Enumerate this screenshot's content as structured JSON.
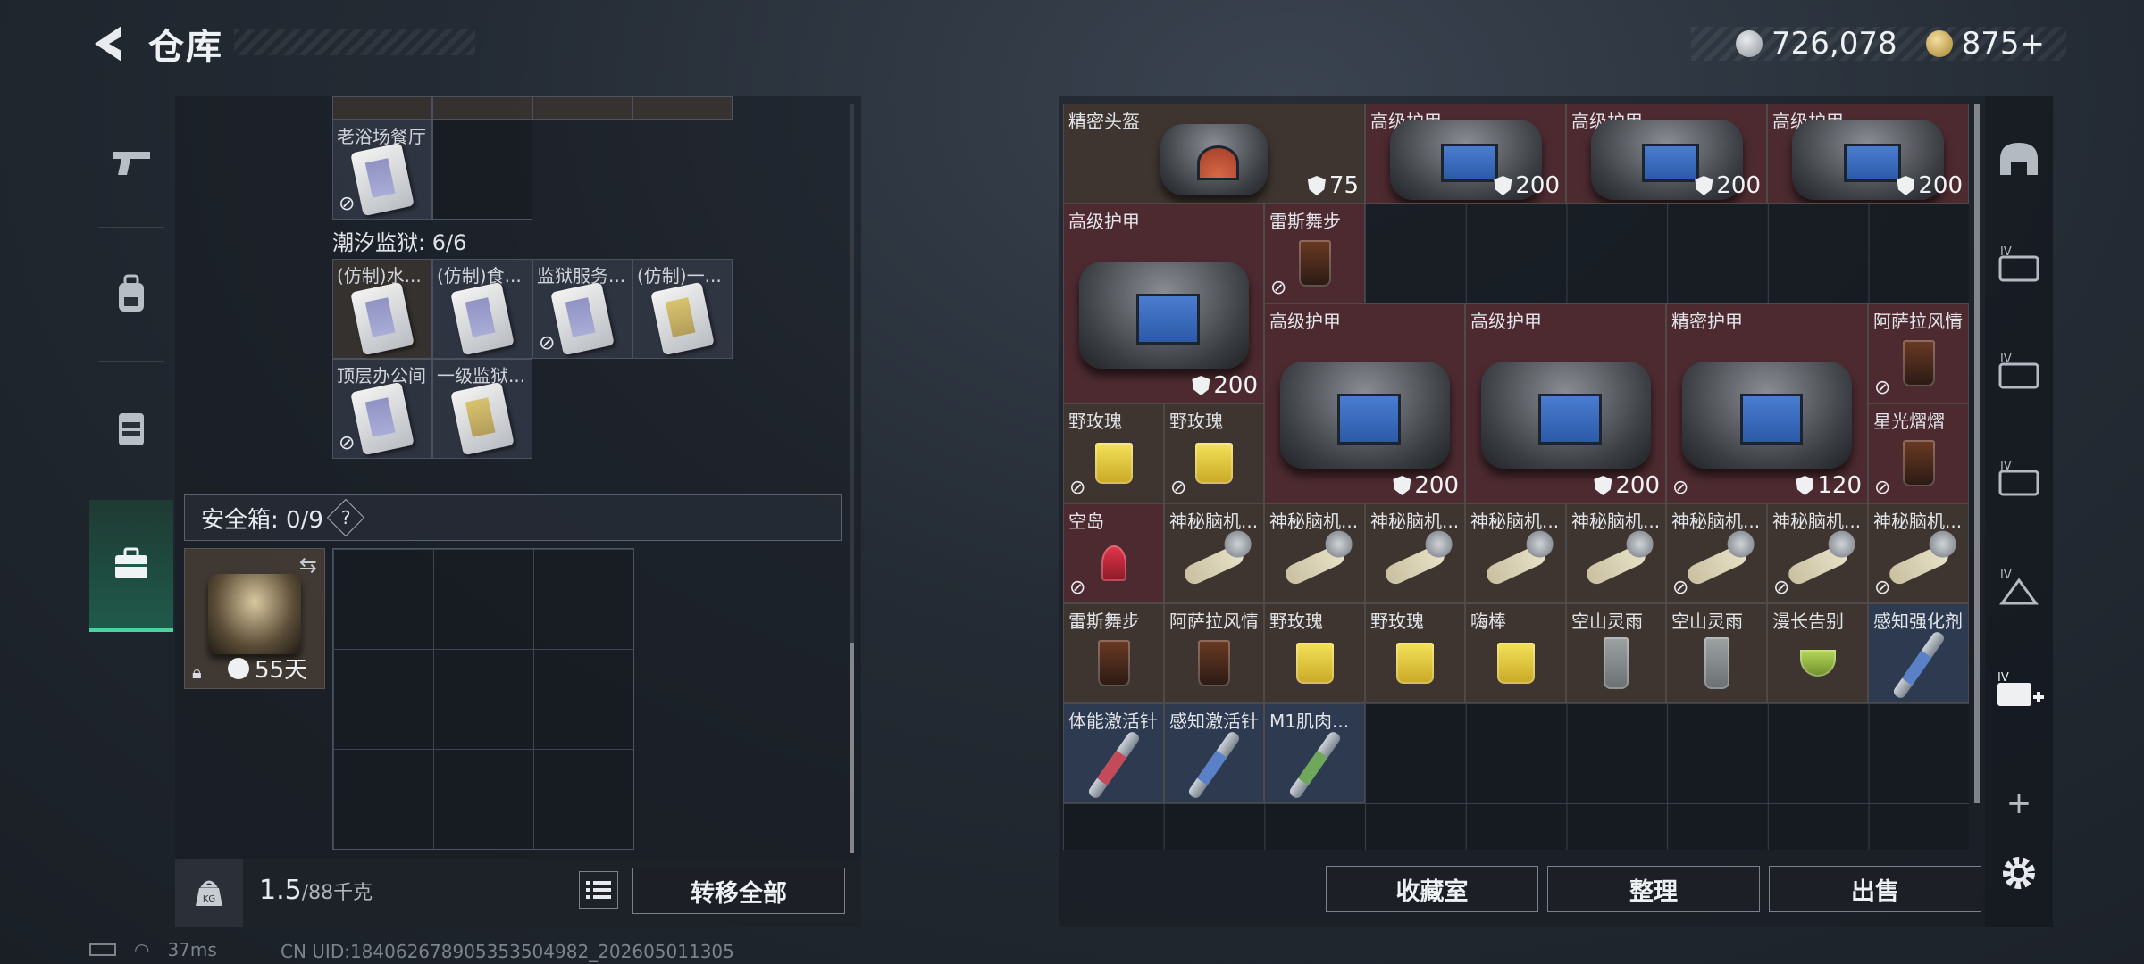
{
  "header": {
    "title": "仓库"
  },
  "currency": {
    "silver": "726,078",
    "gold": "875+"
  },
  "left": {
    "top_cell_label": "老浴场餐厅",
    "group_title": "潮汐监狱: 6/6",
    "group_items": [
      {
        "label": "(仿制)水..."
      },
      {
        "label": "(仿制)食..."
      },
      {
        "label": "监狱服务..."
      },
      {
        "label": "(仿制)一..."
      },
      {
        "label": "顶层办公间"
      },
      {
        "label": "一级监狱..."
      }
    ],
    "safe_label": "安全箱: 0/9",
    "help": "?",
    "safe_timer": "55天",
    "weight_value": "1.5",
    "weight_total": "/88千克",
    "transfer_all": "转移全部"
  },
  "right": {
    "items": {
      "r0c0": "精密头盔",
      "r0c0_dur": "75",
      "r0c3": "高级护甲",
      "r0c3_dur": "200",
      "r0c5": "高级护甲",
      "r0c5_dur": "200",
      "r0c7": "高级护甲",
      "r0c7_dur": "200",
      "r1c0": "高级护甲",
      "r1c0_dur": "200",
      "r1c2": "雷斯舞步",
      "r2c2": "高级护甲",
      "r2c2_dur": "200",
      "r2c4": "高级护甲",
      "r2c4_dur": "200",
      "r2c6": "精密护甲",
      "r2c6_dur": "120",
      "r2c8": "阿萨拉风情",
      "r3c0": "野玫瑰",
      "r3c1": "野玫瑰",
      "r3c8": "星光熠熠",
      "r4": [
        "空岛",
        "神秘脑机...",
        "神秘脑机...",
        "神秘脑机...",
        "神秘脑机...",
        "神秘脑机...",
        "神秘脑机...",
        "神秘脑机...",
        "神秘脑机..."
      ],
      "r5": [
        "雷斯舞步",
        "阿萨拉风情",
        "野玫瑰",
        "野玫瑰",
        "嗨棒",
        "空山灵雨",
        "空山灵雨",
        "漫长告别",
        "感知强化剂"
      ],
      "r6": [
        "体能激活针",
        "感知激活针",
        "M1肌肉..."
      ]
    },
    "buttons": {
      "collection": "收藏室",
      "sort": "整理",
      "sell": "出售"
    }
  },
  "status": {
    "ping": "37ms",
    "uid": "CN UID:18406267890535350498​2_202605011305"
  },
  "icons": [
    "back-arrow-icon",
    "gun-icon",
    "backpack-icon",
    "vest-icon",
    "briefcase-icon",
    "lock-icon",
    "clock-icon",
    "swap-icon",
    "list-icon",
    "kg-weight-icon",
    "shield-icon",
    "no-link-icon",
    "settings-gear-icon",
    "plus-icon"
  ],
  "colors": {
    "accent": "#4ed1a0",
    "rare_red": "#4c2a30",
    "legend_brown": "#3e3530",
    "epic_blue": "#2e3a50"
  }
}
